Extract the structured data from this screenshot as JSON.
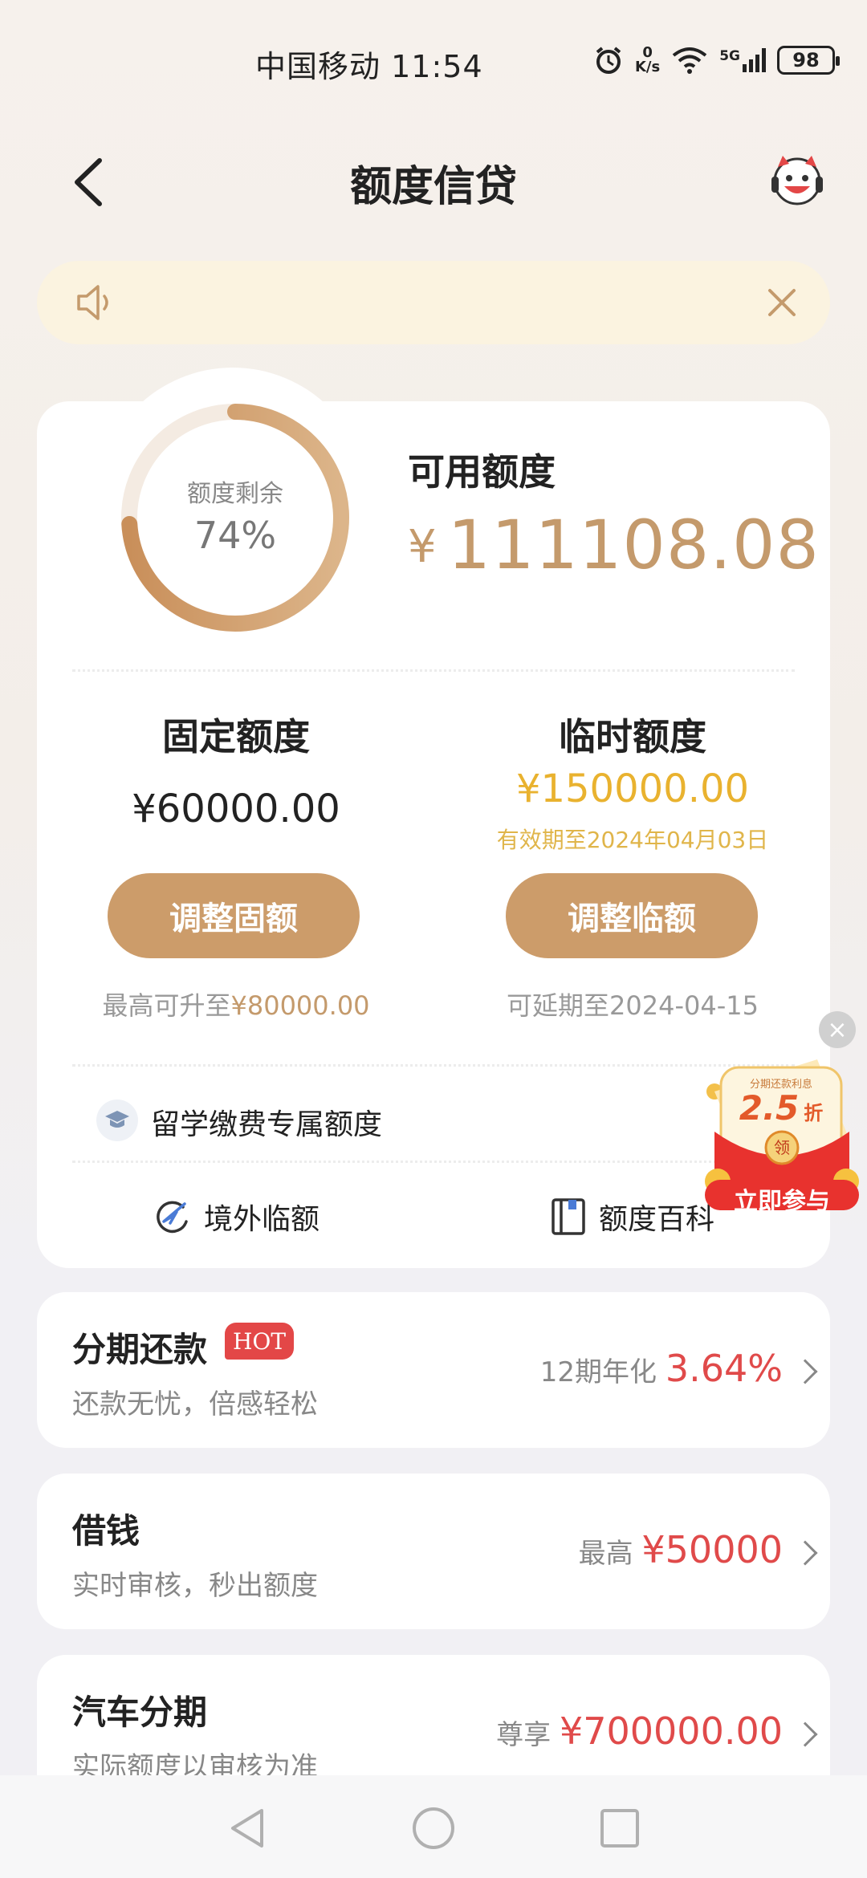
{
  "status_bar": {
    "carrier": "中国移动",
    "time": "11:54",
    "net_speed_value": "0",
    "net_speed_unit": "K/s",
    "network": "5G",
    "battery": "98"
  },
  "header": {
    "title": "额度信贷"
  },
  "notice": {
    "text": ""
  },
  "credit": {
    "remaining_label": "额度剩余",
    "remaining_percent": "74%",
    "remaining_fraction": 0.74,
    "available_label": "可用额度",
    "currency": "¥",
    "available_amount": "111108.08"
  },
  "fixed": {
    "title": "固定额度",
    "amount": "¥60000.00",
    "button": "调整固额",
    "note_prefix": "最高可升至",
    "note_value": "¥80000.00"
  },
  "temporary": {
    "title": "临时额度",
    "amount": "¥150000.00",
    "valid_until": "有效期至2024年04月03日",
    "button": "调整临额",
    "note": "可延期至2024-04-15"
  },
  "study": {
    "label": "留学缴费专属额度"
  },
  "tools": {
    "overseas": "境外临额",
    "wiki": "额度百科"
  },
  "promo": {
    "top_text": "分期还款利息",
    "discount": "2.5",
    "discount_unit": "折",
    "coin": "领",
    "cta": "立即参与"
  },
  "products": [
    {
      "title": "分期还款",
      "badge": "HOT",
      "subtitle": "还款无忧，倍感轻松",
      "right_prefix": "12期年化",
      "right_value": "3.64%"
    },
    {
      "title": "借钱",
      "subtitle": "实时审核，秒出额度",
      "right_prefix": "最高",
      "right_value": "¥50000"
    },
    {
      "title": "汽车分期",
      "subtitle": "实际额度以审核为准",
      "right_prefix": "尊享",
      "right_value": "¥700000.00"
    }
  ],
  "colors": {
    "accent_gold": "#cc9c6a",
    "temp_yellow": "#e9b22f",
    "rate_red": "#e04a4a",
    "hot_badge": "#e34747"
  }
}
